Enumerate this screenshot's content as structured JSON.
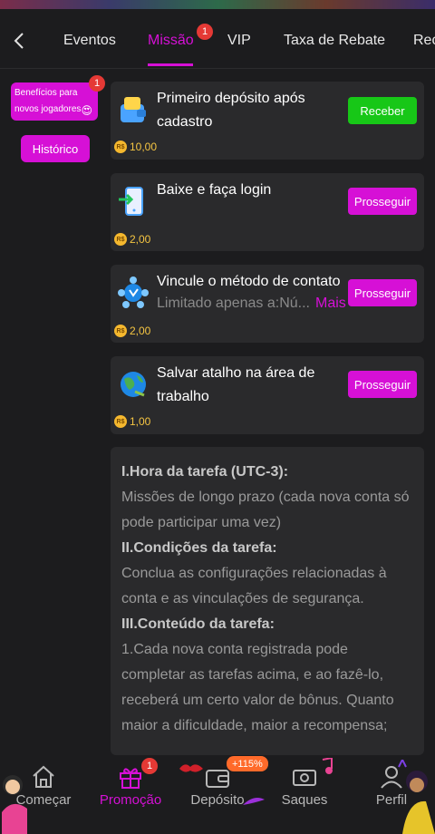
{
  "tabs": [
    {
      "label": "Eventos"
    },
    {
      "label": "Missão",
      "badge": "1",
      "active": true
    },
    {
      "label": "VIP"
    },
    {
      "label": "Taxa de Rebate"
    },
    {
      "label": "Rec"
    }
  ],
  "sidebar": {
    "benefits": {
      "line1": "Benefícios para",
      "line2": "novos jogadores",
      "emoji": "😍",
      "badge": "1"
    },
    "history": "Histórico"
  },
  "missions": [
    {
      "title": "Primeiro depósito após cadastro",
      "reward": "10,00",
      "action": "Receber",
      "icon": "wallet-icon"
    },
    {
      "title": "Baixe e faça login",
      "reward": "2,00",
      "action": "Prosseguir",
      "icon": "phone-download-icon"
    },
    {
      "title": "Vincule o método de contato",
      "subtitle": "Limitado apenas a:Nú...",
      "more": "Mais",
      "reward": "2,00",
      "action": "Prosseguir",
      "icon": "contact-link-icon"
    },
    {
      "title": "Salvar atalho na área de trabalho",
      "reward": "1,00",
      "action": "Prosseguir",
      "icon": "globe-icon"
    }
  ],
  "currency_symbol": "R$",
  "rules": {
    "h1": "I.Hora da tarefa (UTC-3):",
    "p1": "Missões de longo prazo (cada nova conta só pode participar uma vez)",
    "h2": "II.Condições da tarefa:",
    "p2": "Conclua as configurações relacionadas à conta e as vinculações de segurança.",
    "h3": "III.Conteúdo da tarefa:",
    "p3": "1.Cada nova conta registrada pode completar as tarefas acima, e ao fazê-lo, receberá um certo valor de bônus. Quanto maior a dificuldade, maior a recompensa;"
  },
  "bottom_nav": [
    {
      "label": "Começar",
      "icon": "home-icon"
    },
    {
      "label": "Promoção",
      "icon": "gift-icon",
      "badge": "1",
      "active": true
    },
    {
      "label": "Depósito",
      "icon": "wallet-icon",
      "promo": "+115%"
    },
    {
      "label": "Saques",
      "icon": "withdraw-icon"
    },
    {
      "label": "Perfil",
      "icon": "profile-icon"
    }
  ],
  "colors": {
    "accent": "#d610d6",
    "success": "#17c717",
    "badge": "#e53935",
    "coin": "#f5b82e"
  }
}
